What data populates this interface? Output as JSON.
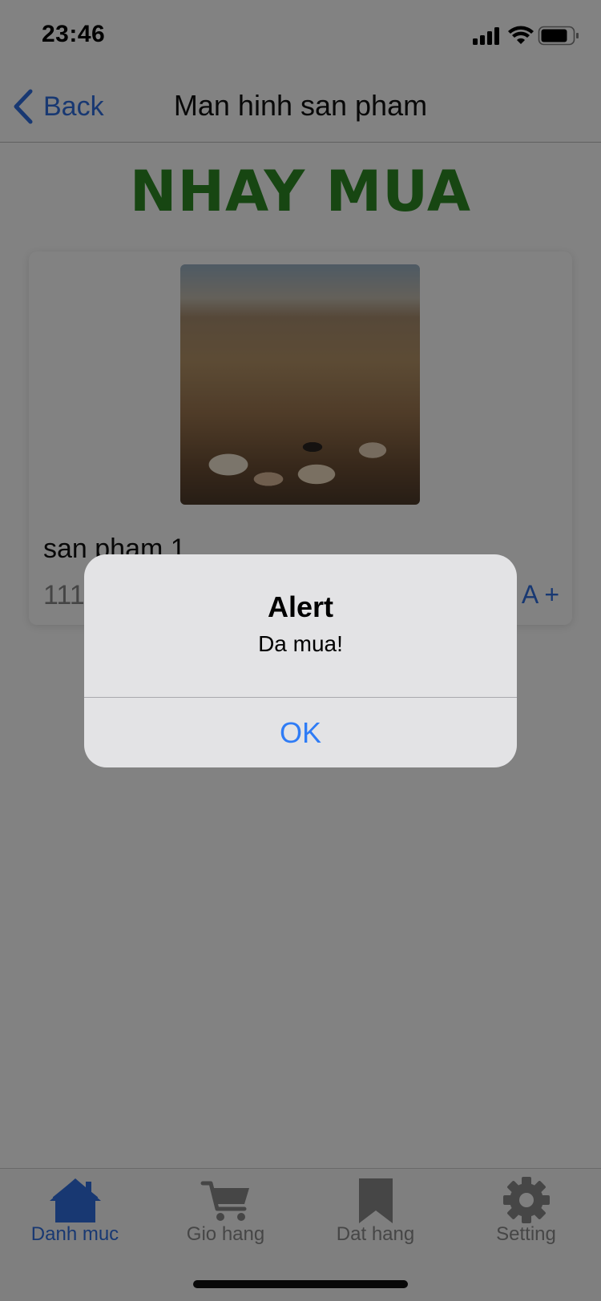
{
  "status_bar": {
    "time": "23:46"
  },
  "nav": {
    "back_label": "Back",
    "title": "Man hinh san pham"
  },
  "brand_title": "NHAY MUA",
  "product": {
    "name": "san pham 1",
    "price": "1110",
    "buy_label": "A +"
  },
  "tabs": [
    {
      "label": "Danh muc",
      "icon": "home-icon",
      "active": true
    },
    {
      "label": "Gio hang",
      "icon": "cart-icon",
      "active": false
    },
    {
      "label": "Dat hang",
      "icon": "bookmark-icon",
      "active": false
    },
    {
      "label": "Setting",
      "icon": "gear-icon",
      "active": false
    }
  ],
  "alert": {
    "title": "Alert",
    "message": "Da mua!",
    "ok_label": "OK"
  },
  "colors": {
    "accent": "#2f6fe0",
    "brand_green": "#2d8a25",
    "inactive_tab": "#8a8a8a"
  }
}
